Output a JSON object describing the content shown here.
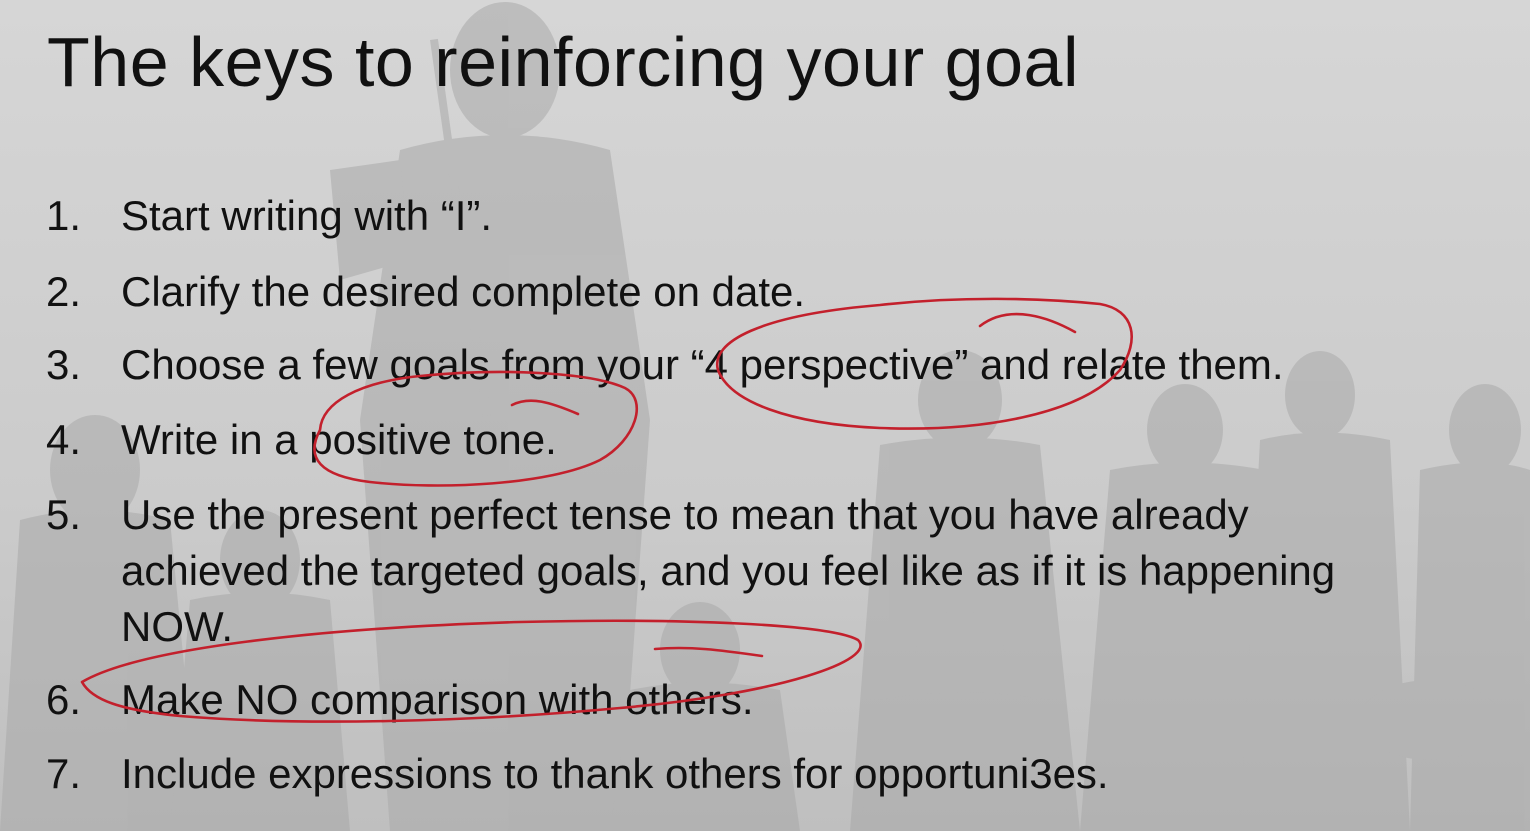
{
  "slide": {
    "title": "The keys to reinforcing your goal",
    "items": [
      {
        "number": "1.",
        "text": "Start writing with “I”."
      },
      {
        "number": "2.",
        "text": "Clarify the desired complete on date."
      },
      {
        "number": "3.",
        "text": "Choose a few goals from your “4 perspective” and relate  them."
      },
      {
        "number": "4.",
        "text": "Write in a positive tone."
      },
      {
        "number": "5.",
        "text": "Use the present perfect tense to mean that you have  already\nachieved the targeted goals, and you feel like as if  it is happening\nNOW."
      },
      {
        "number": "6.",
        "text": "Make NO comparison with others."
      },
      {
        "number": "7.",
        "text": "Include expressions to thank others for opportuni3es."
      }
    ]
  },
  "colors": {
    "background": "#cfcfcf",
    "text": "#111111",
    "annotation": "#c3202c"
  }
}
